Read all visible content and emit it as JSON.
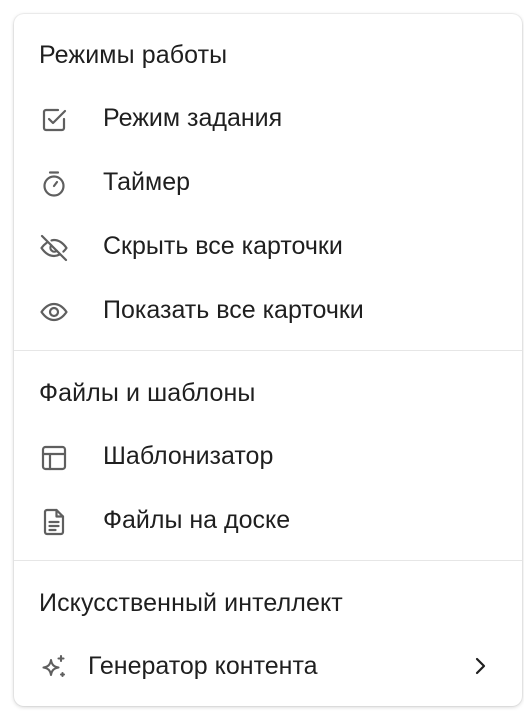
{
  "sections": [
    {
      "title": "Режимы работы",
      "items": [
        {
          "label": "Режим задания",
          "icon": "checkbox-icon"
        },
        {
          "label": "Таймер",
          "icon": "stopwatch-icon"
        },
        {
          "label": "Скрыть все карточки",
          "icon": "eye-off-icon"
        },
        {
          "label": "Показать все карточки",
          "icon": "eye-icon"
        }
      ]
    },
    {
      "title": "Файлы и шаблоны",
      "items": [
        {
          "label": "Шаблонизатор",
          "icon": "template-icon"
        },
        {
          "label": "Файлы на доске",
          "icon": "document-icon"
        }
      ]
    },
    {
      "title": "Искусственный интеллект",
      "items": [
        {
          "label": "Генератор контента",
          "icon": "sparkle-icon",
          "submenu_icon": "chevron-right-icon"
        }
      ]
    }
  ],
  "colors": {
    "text": "#1f1f1f",
    "icon": "#5f5f5f",
    "divider": "#e6e6e6",
    "background": "#ffffff"
  }
}
